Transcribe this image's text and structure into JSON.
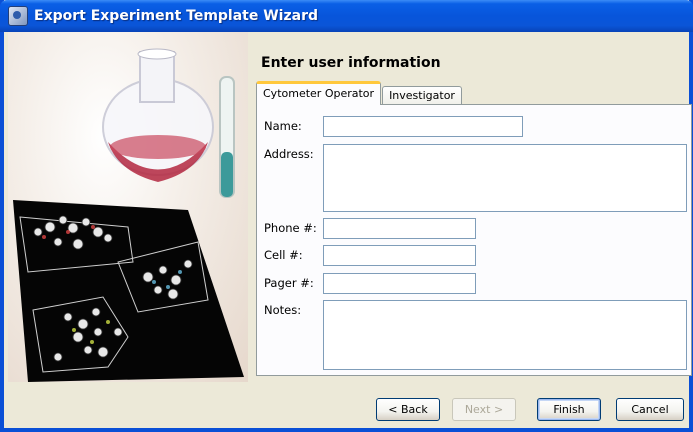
{
  "window": {
    "title": "Export Experiment Template Wizard"
  },
  "page": {
    "heading": "Enter user information"
  },
  "tabs": [
    {
      "label": "Cytometer Operator",
      "active": true
    },
    {
      "label": "Investigator",
      "active": false
    }
  ],
  "form": {
    "name_label": "Name:",
    "name_value": "",
    "address_label": "Address:",
    "address_value": "",
    "phone_label": "Phone #:",
    "phone_value": "",
    "cell_label": "Cell #:",
    "cell_value": "",
    "pager_label": "Pager #:",
    "pager_value": "",
    "notes_label": "Notes:",
    "notes_value": ""
  },
  "buttons": {
    "back": "< Back",
    "next": "Next >",
    "finish": "Finish",
    "cancel": "Cancel"
  },
  "colors": {
    "titlebar": "#0a55d8",
    "window_bg": "#ece9d8",
    "tab_highlight": "#ffc83c",
    "field_border": "#7f9db9"
  }
}
